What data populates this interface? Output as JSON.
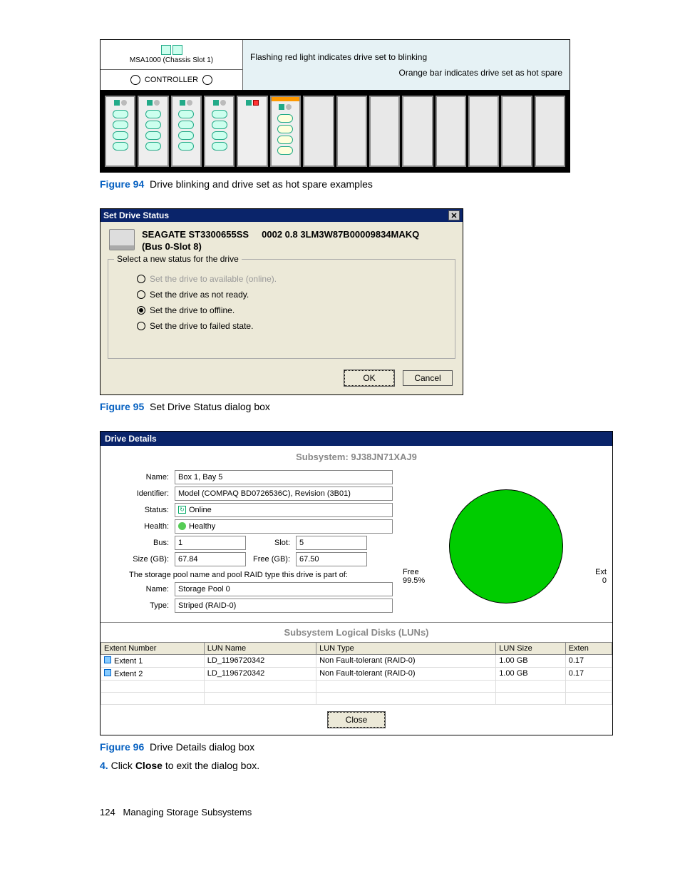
{
  "fig94": {
    "chassis_label": "MSA1000 (Chassis Slot 1)",
    "controller_label": "CONTROLLER",
    "annot_flash": "Flashing red light indicates drive set to blinking",
    "annot_orange": "Orange bar indicates drive set as hot spare",
    "caption_num": "Figure 94",
    "caption_text": "Drive blinking and drive set as hot spare examples"
  },
  "dlg_set_drive": {
    "title": "Set Drive Status",
    "drive_model": "SEAGATE  ST3300655SS",
    "drive_loc": "(Bus 0-Slot 8)",
    "drive_serial": "0002 0.8 3LM3W87B00009834MAKQ",
    "legend": "Select a new status for the drive",
    "opt1": "Set the drive to available (online).",
    "opt2": "Set the drive as not ready.",
    "opt3": "Set the drive to offline.",
    "opt4": "Set the drive to failed state.",
    "ok": "OK",
    "cancel": "Cancel"
  },
  "fig95": {
    "caption_num": "Figure 95",
    "caption_text": "Set Drive Status dialog box"
  },
  "dlg_details": {
    "title": "Drive Details",
    "subsystem": "Subsystem: 9J38JN71XAJ9",
    "labels": {
      "name": "Name:",
      "identifier": "Identifier:",
      "status": "Status:",
      "health": "Health:",
      "bus": "Bus:",
      "slot": "Slot:",
      "size": "Size (GB):",
      "free": "Free (GB):",
      "poolname": "Name:",
      "type": "Type:"
    },
    "vals": {
      "name": "Box 1, Bay 5",
      "identifier": "Model (COMPAQ BD0726536C), Revision (3B01)",
      "status": "Online",
      "health": "Healthy",
      "bus": "1",
      "slot": "5",
      "size": "67.84",
      "free": "67.50",
      "poolname": "Storage Pool 0",
      "type": "Striped (RAID-0)"
    },
    "pool_note": "The storage pool name and pool RAID type this drive is part of:",
    "chart_free_lbl": "Free",
    "chart_free_pct": "99.5%",
    "chart_ext_lbl": "Ext",
    "chart_ext_val": "0",
    "lun_title": "Subsystem Logical Disks (LUNs)",
    "lun_headers": [
      "Extent Number",
      "LUN Name",
      "LUN Type",
      "LUN Size",
      "Exten"
    ],
    "lun_rows": [
      {
        "ext": "Extent 1",
        "name": "LD_1196720342",
        "type": "Non Fault-tolerant (RAID-0)",
        "size": "1.00 GB",
        "e": "0.17"
      },
      {
        "ext": "Extent 2",
        "name": "LD_1196720342",
        "type": "Non Fault-tolerant (RAID-0)",
        "size": "1.00 GB",
        "e": "0.17"
      }
    ],
    "close": "Close"
  },
  "fig96": {
    "caption_num": "Figure 96",
    "caption_text": "Drive Details dialog box"
  },
  "step": {
    "num": "4.",
    "pre": "Click ",
    "bold": "Close",
    "post": " to exit the dialog box."
  },
  "footer": {
    "page": "124",
    "section": "Managing Storage Subsystems"
  },
  "chart_data": {
    "type": "pie",
    "title": "Drive capacity",
    "series": [
      {
        "name": "Free",
        "value": 99.5
      },
      {
        "name": "Ext",
        "value": 0.5
      }
    ]
  }
}
